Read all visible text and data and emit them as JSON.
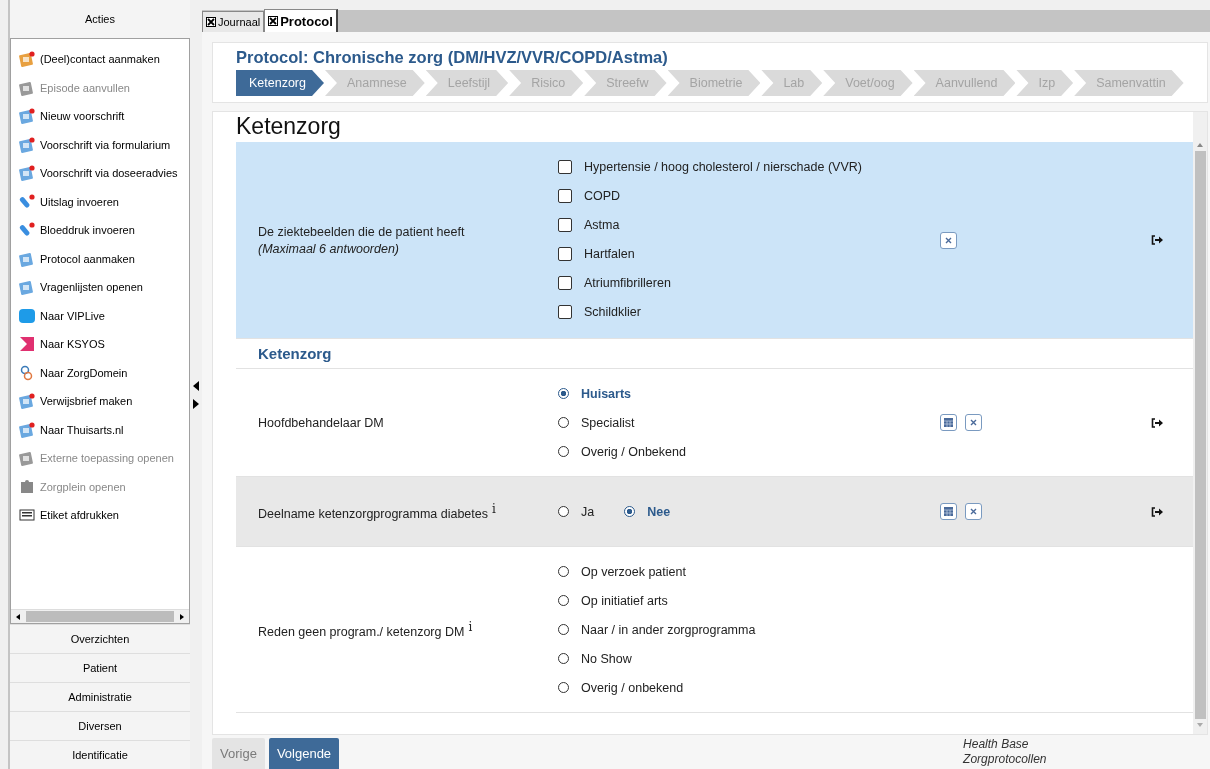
{
  "sidebar": {
    "header": "Acties",
    "actions": [
      {
        "label": "(Deel)contact aanmaken",
        "disabled": false
      },
      {
        "label": "Episode aanvullen",
        "disabled": true
      },
      {
        "label": "Nieuw voorschrift",
        "disabled": false
      },
      {
        "label": "Voorschrift via formularium",
        "disabled": false
      },
      {
        "label": "Voorschrift via doseeradvies",
        "disabled": false
      },
      {
        "label": "Uitslag invoeren",
        "disabled": false
      },
      {
        "label": "Bloeddruk invoeren",
        "disabled": false
      },
      {
        "label": "Protocol aanmaken",
        "disabled": false
      },
      {
        "label": "Vragenlijsten openen",
        "disabled": false
      },
      {
        "label": "Naar VIPLive",
        "disabled": false
      },
      {
        "label": "Naar KSYOS",
        "disabled": false
      },
      {
        "label": "Naar ZorgDomein",
        "disabled": false
      },
      {
        "label": "Verwijsbrief maken",
        "disabled": false
      },
      {
        "label": "Naar Thuisarts.nl",
        "disabled": false
      },
      {
        "label": "Externe toepassing openen",
        "disabled": true
      },
      {
        "label": "Zorgplein openen",
        "disabled": true
      },
      {
        "label": "Etiket afdrukken",
        "disabled": false
      }
    ],
    "sections": [
      "Overzichten",
      "Patient",
      "Administratie",
      "Diversen",
      "Identificatie"
    ]
  },
  "tabs": [
    {
      "label": "Journaal",
      "selected": false
    },
    {
      "label": "Protocol",
      "selected": true
    }
  ],
  "protocol": {
    "title": "Protocol: Chronische zorg (DM/HVZ/VVR/COPD/Astma)",
    "steps": [
      {
        "label": "Ketenzorg",
        "selected": true
      },
      {
        "label": "Anamnese",
        "selected": false
      },
      {
        "label": "Leefstijl",
        "selected": false
      },
      {
        "label": "Risico",
        "selected": false
      },
      {
        "label": "Streefw",
        "selected": false
      },
      {
        "label": "Biometrie",
        "selected": false
      },
      {
        "label": "Lab",
        "selected": false
      },
      {
        "label": "Voet/oog",
        "selected": false
      },
      {
        "label": "Aanvullend",
        "selected": false
      },
      {
        "label": "Izp",
        "selected": false
      },
      {
        "label": "Samenvattin",
        "selected": false
      }
    ]
  },
  "form": {
    "heading": "Ketenzorg",
    "items": [
      {
        "kind": "checkboxes",
        "label": "De ziektebeelden die de patient heeft",
        "note": "(Maximaal 6 antwoorden)",
        "focused": true,
        "hovered": false,
        "date_button": false,
        "clear_button": true,
        "link_out": true,
        "options": [
          {
            "label": "Hypertensie / hoog cholesterol / nierschade (VVR)",
            "checked": false
          },
          {
            "label": "COPD",
            "checked": false
          },
          {
            "label": "Astma",
            "checked": false
          },
          {
            "label": "Hartfalen",
            "checked": false
          },
          {
            "label": "Atriumfibrilleren",
            "checked": false
          },
          {
            "label": "Schildklier",
            "checked": false
          }
        ]
      },
      {
        "kind": "section",
        "label": "Ketenzorg"
      },
      {
        "kind": "radios",
        "label": "Hoofdbehandelaar DM",
        "focused": false,
        "hovered": false,
        "date_button": true,
        "clear_button": true,
        "link_out": true,
        "options": [
          {
            "label": "Huisarts",
            "selected": true
          },
          {
            "label": "Specialist",
            "selected": false
          },
          {
            "label": "Overig / Onbekend",
            "selected": false
          }
        ]
      },
      {
        "kind": "inline_radios",
        "label": "Deelname ketenzorgprogramma diabetes",
        "info": "i",
        "focused": false,
        "hovered": true,
        "date_button": true,
        "clear_button": true,
        "link_out": true,
        "options": [
          {
            "label": "Ja",
            "selected": false
          },
          {
            "label": "Nee",
            "selected": true
          }
        ]
      },
      {
        "kind": "radios",
        "label": "Reden geen program./ ketenzorg DM",
        "info": "i",
        "focused": false,
        "hovered": false,
        "date_button": false,
        "clear_button": false,
        "link_out": false,
        "options": [
          {
            "label": "Op verzoek patient",
            "selected": false
          },
          {
            "label": "Op initiatief arts",
            "selected": false
          },
          {
            "label": "Naar / in ander zorgprogramma",
            "selected": false
          },
          {
            "label": "No Show",
            "selected": false
          },
          {
            "label": "Overig / onbekend",
            "selected": false
          }
        ]
      }
    ]
  },
  "footer": {
    "buttons": [
      {
        "label": "Vorige",
        "disabled": true
      },
      {
        "label": "Volgende",
        "disabled": false
      }
    ],
    "credit": [
      "Health Base",
      "Zorgprotocollen"
    ]
  }
}
